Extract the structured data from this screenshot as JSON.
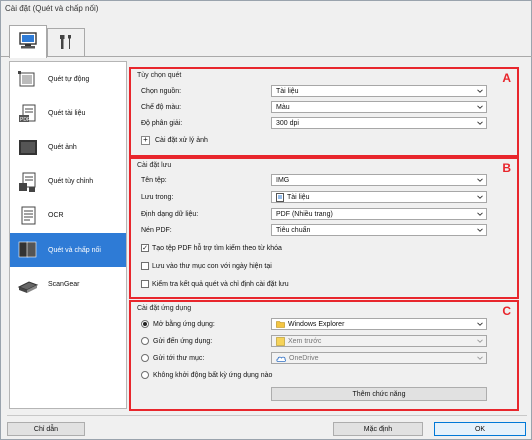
{
  "window": {
    "title": "Cài đặt (Quét và chấp nối)"
  },
  "tabs": [
    {
      "name": "scan-settings-tab",
      "icon": "computer-icon"
    },
    {
      "name": "general-settings-tab",
      "icon": "tools-icon"
    }
  ],
  "nav": {
    "items": [
      {
        "label": "Quét tự động",
        "icon": "auto-scan-icon"
      },
      {
        "label": "Quét tài liệu",
        "icon": "document-scan-icon"
      },
      {
        "label": "Quét ảnh",
        "icon": "photo-scan-icon"
      },
      {
        "label": "Quét tùy chỉnh",
        "icon": "custom-scan-icon"
      },
      {
        "label": "OCR",
        "icon": "ocr-icon"
      },
      {
        "label": "Quét và chấp nối",
        "icon": "stitch-icon"
      },
      {
        "label": "ScanGear",
        "icon": "scangear-icon"
      }
    ],
    "selected_index": 5
  },
  "scan_options": {
    "title": "Tùy chọn quét",
    "letter": "A",
    "source_label": "Chọn nguồn:",
    "source_value": "Tài liệu",
    "color_label": "Chế độ màu:",
    "color_value": "Màu",
    "resolution_label": "Độ phân giải:",
    "resolution_value": "300 dpi",
    "image_processing_label": "Cài đặt xử lý ảnh"
  },
  "save_settings": {
    "title": "Cài đặt lưu",
    "letter": "B",
    "filename_label": "Tên tệp:",
    "filename_value": "IMG",
    "save_in_label": "Lưu trong:",
    "save_in_value": "Tài liệu",
    "format_label": "Định dạng dữ liệu:",
    "format_value": "PDF (Nhiều trang)",
    "pdf_compression_label": "Nén PDF:",
    "pdf_compression_value": "Tiêu chuẩn",
    "cb_searchable_label": "Tạo tệp PDF hỗ trợ tìm kiếm theo từ khóa",
    "cb_searchable_checked": true,
    "cb_subfolder_label": "Lưu vào thư mục con với ngày hiện tại",
    "cb_subfolder_checked": false,
    "cb_check_results_label": "Kiểm tra kết quả quét và chỉ định cài đặt lưu",
    "cb_check_results_checked": false
  },
  "app_settings": {
    "title": "Cài đặt ứng dụng",
    "letter": "C",
    "open_with_label": "Mở bằng ứng dụng:",
    "open_with_value": "Windows Explorer",
    "send_to_app_label": "Gửi đến ứng dụng:",
    "send_to_app_value": "Xem trước",
    "send_to_folder_label": "Gửi tới thư mục:",
    "send_to_folder_value": "OneDrive",
    "no_app_label": "Không khởi động bất kỳ ứng dụng nào",
    "selected_option": "open_with",
    "more_functions_label": "Thêm chức năng"
  },
  "footer": {
    "help_label": "Chỉ dẫn",
    "defaults_label": "Mặc định",
    "ok_label": "OK"
  },
  "colors": {
    "selection": "#2e7bd6",
    "highlight_border": "#e8262c"
  }
}
